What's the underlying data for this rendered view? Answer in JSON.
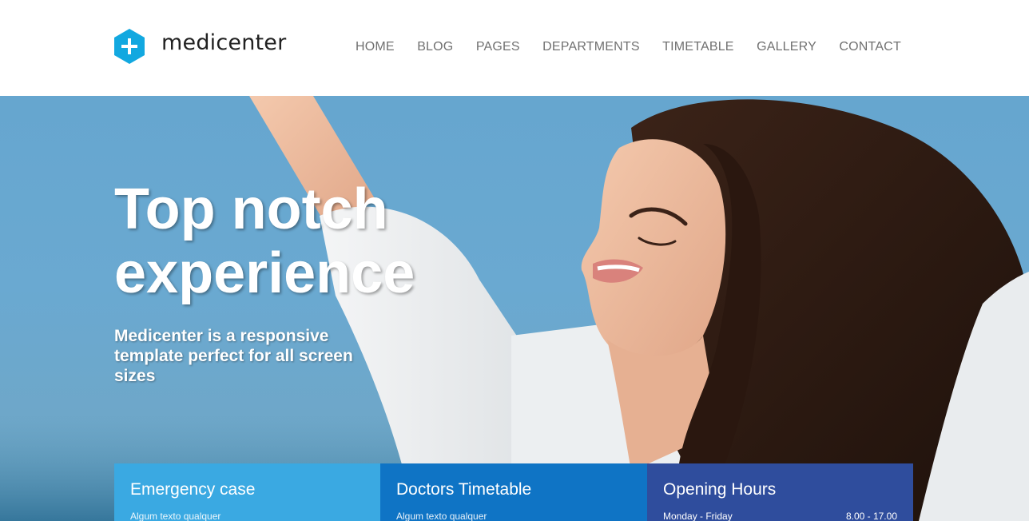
{
  "brand": {
    "name": "medicenter",
    "accent": "#12a8e0"
  },
  "nav": {
    "items": [
      {
        "label": "HOME"
      },
      {
        "label": "BLOG"
      },
      {
        "label": "PAGES"
      },
      {
        "label": "DEPARTMENTS"
      },
      {
        "label": "TIMETABLE"
      },
      {
        "label": "GALLERY"
      },
      {
        "label": "CONTACT"
      }
    ]
  },
  "hero": {
    "title_line1": "Top notch",
    "title_line2": "experience",
    "subtitle": "Medicenter is a responsive template perfect for all screen sizes",
    "image": "woman-smiling-arms-raised-blue-sky"
  },
  "boxes": [
    {
      "title": "Emergency case",
      "text": "Algum texto qualquer",
      "color": "#3aa9e2"
    },
    {
      "title": "Doctors Timetable",
      "text": "Algum texto qualquer",
      "color": "#0f74c5"
    },
    {
      "title": "Opening Hours",
      "row_day": "Monday - Friday",
      "row_time": "8.00 - 17.00",
      "color": "#2f4d9d"
    }
  ]
}
